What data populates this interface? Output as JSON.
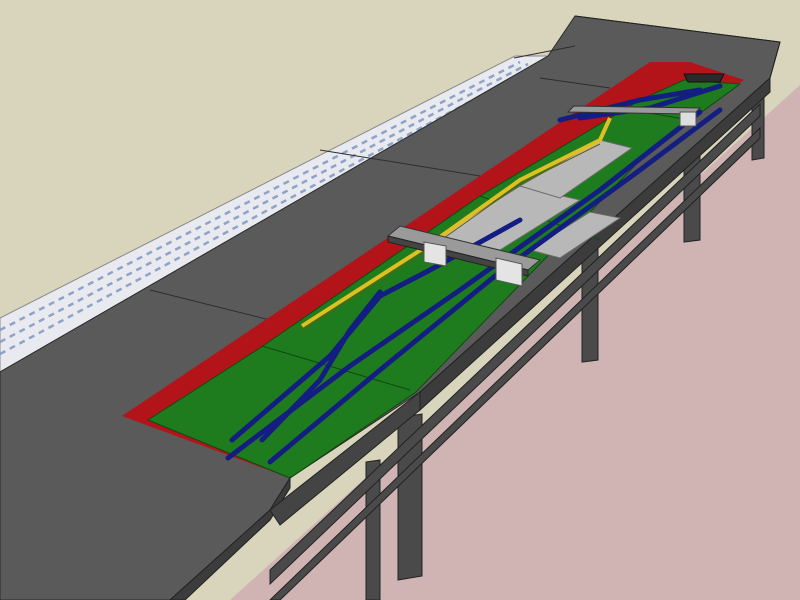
{
  "scene": {
    "colors": {
      "background": "#d9d5bd",
      "floor": "#d0b4b4",
      "shelf_top": "#585858",
      "shelf_side": "#3c3c3c",
      "legs": "#484848",
      "valance": "#3a3a3a",
      "scenery_green": "#1e7c1e",
      "backdrop_red": "#b3141a",
      "track_blue": "#141e82",
      "siding_yellow": "#e0c020",
      "platform_grey": "#b8b8b8",
      "bridge_grey": "#9a9a9a",
      "drawing_paper": "#e6e8ee",
      "drawing_lines": "#8fa3c8"
    }
  }
}
